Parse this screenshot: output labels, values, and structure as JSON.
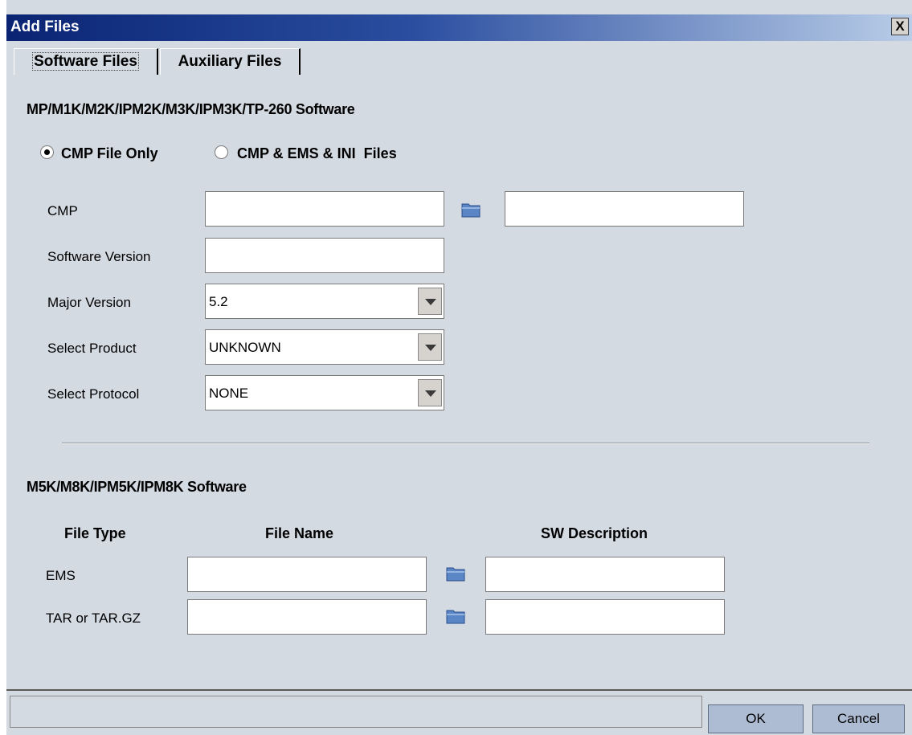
{
  "window": {
    "title": "Add Files",
    "close_label": "X"
  },
  "tabs": [
    {
      "label": "Software Files",
      "active": true
    },
    {
      "label": "Auxiliary Files",
      "active": false
    }
  ],
  "section1": {
    "title": "MP/M1K/M2K/IPM2K/M3K/IPM3K/TP-260 Software",
    "radio_options": [
      {
        "label": "CMP File Only",
        "checked": true
      },
      {
        "label": "CMP & EMS & INI  Files",
        "checked": false
      }
    ],
    "fields": {
      "cmp": {
        "label": "CMP",
        "value": "",
        "description": ""
      },
      "software_version": {
        "label": "Software Version",
        "value": ""
      },
      "major_version": {
        "label": "Major Version",
        "value": "5.2"
      },
      "select_product": {
        "label": "Select Product",
        "value": "UNKNOWN"
      },
      "select_protocol": {
        "label": "Select Protocol",
        "value": "NONE"
      }
    }
  },
  "section2": {
    "title": "M5K/M8K/IPM5K/IPM8K Software",
    "columns": {
      "file_type": "File Type",
      "file_name": "File Name",
      "sw_description": "SW Description"
    },
    "rows": [
      {
        "type": "EMS",
        "file_name": "",
        "description": ""
      },
      {
        "type": "TAR or TAR.GZ",
        "file_name": "",
        "description": ""
      }
    ]
  },
  "footer": {
    "ok_label": "OK",
    "cancel_label": "Cancel"
  },
  "icons": {
    "browse": "folder-icon"
  },
  "colors": {
    "title_bar_start": "#0a2473",
    "dialog_bg": "#d4dae2",
    "button_bg": "#aebcd3"
  }
}
